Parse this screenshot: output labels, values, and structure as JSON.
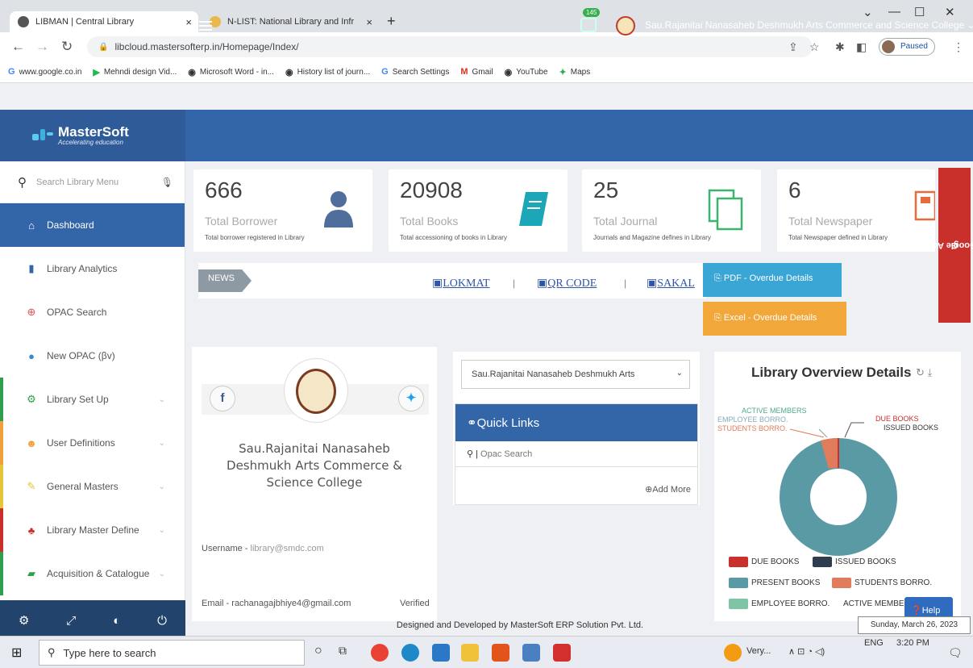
{
  "browser": {
    "tabs": [
      {
        "title": "LIBMAN | Central Library",
        "close": "×"
      },
      {
        "title": "N-LIST: National Library and Infr",
        "close": "×"
      }
    ],
    "new_tab": "+",
    "url": "libcloud.mastersofterp.in/Homepage/Index/",
    "profile_status": "Paused",
    "bookmarks": [
      "www.google.co.in",
      "Mehndi design Vid...",
      "Microsoft Word - in...",
      "History list of journ...",
      "Search Settings",
      "Gmail",
      "YouTube",
      "Maps"
    ]
  },
  "header": {
    "brand": "MasterSoft",
    "tagline": "Accelerating education",
    "notification_count": "145",
    "college_name": "Sau.Rajanitai Nanasaheb Deshmukh Arts Commerce and Science College"
  },
  "sidebar": {
    "search_placeholder": "Search Library Menu",
    "items": [
      {
        "label": "Dashboard",
        "icon": "home-icon"
      },
      {
        "label": "Library Analytics",
        "icon": "bar-chart-icon"
      },
      {
        "label": "OPAC Search",
        "icon": "search-icon"
      },
      {
        "label": "New OPAC (βv)",
        "icon": "globe-icon"
      },
      {
        "label": "Library Set Up",
        "icon": "gears-icon"
      },
      {
        "label": "User Definitions",
        "icon": "users-icon"
      },
      {
        "label": "General Masters",
        "icon": "edit-icon"
      },
      {
        "label": "Library Master Define",
        "icon": "sitemap-icon"
      },
      {
        "label": "Acquisition & Catalogue",
        "icon": "book-icon"
      }
    ]
  },
  "stats": [
    {
      "value": "666",
      "label": "Total Borrower",
      "desc": "Total borrower registered in Library"
    },
    {
      "value": "20908",
      "label": "Total Books",
      "desc": "Total accessioning of books in Library"
    },
    {
      "value": "25",
      "label": "Total Journal",
      "desc": "Journals and Magazine defines in Library"
    },
    {
      "value": "6",
      "label": "Total Newspaper",
      "desc": "Total Newspaper defined in Library"
    }
  ],
  "news": {
    "tag": "NEWS",
    "links": [
      "LOKMAT",
      "QR CODE",
      "SAKAL"
    ],
    "separator": "|"
  },
  "buttons": {
    "pdf": "PDF - Overdue Details",
    "excel": "Excel - Overdue Details",
    "sync": "Sync Google Account",
    "help": "Help"
  },
  "profile": {
    "name": "Sau.Rajanitai Nanasaheb Deshmukh Arts Commerce & Science College",
    "username_label": "Username - ",
    "username": "library@smdc.com",
    "email_label": "Email - ",
    "email": "rachanagajbhiye4@gmail.com",
    "verified": "Verified"
  },
  "quick_links": {
    "select_value": "Sau.Rajanitai Nanasaheb Deshmukh Arts",
    "title": "Quick Links",
    "items": [
      "Opac Search"
    ],
    "add_more": "Add More"
  },
  "overview": {
    "title": "Library Overview Details",
    "callouts": [
      "ACTIVE MEMBERS",
      "EMPLOYEE BORRO.",
      "STUDENTS BORRO.",
      "DUE BOOKS",
      "ISSUED BOOKS"
    ],
    "legend": [
      {
        "label": "DUE BOOKS",
        "color": "#c9302c"
      },
      {
        "label": "ISSUED BOOKS",
        "color": "#2e3e4e"
      },
      {
        "label": "PRESENT BOOKS",
        "color": "#5a9aa5"
      },
      {
        "label": "STUDENTS BORRO.",
        "color": "#e07c5c"
      },
      {
        "label": "EMPLOYEE BORRO.",
        "color": "#7ec4a5"
      },
      {
        "label": "ACTIVE MEMBERS",
        "color": "#4f8a5a"
      }
    ]
  },
  "footer": "Designed and Developed by MasterSoft ERP Solution Pvt. Ltd.",
  "taskbar": {
    "search_placeholder": "Type here to search",
    "weather": "Very...",
    "lang": "ENG",
    "time": "3:20 PM",
    "date_tooltip": "Sunday, March 26, 2023"
  }
}
